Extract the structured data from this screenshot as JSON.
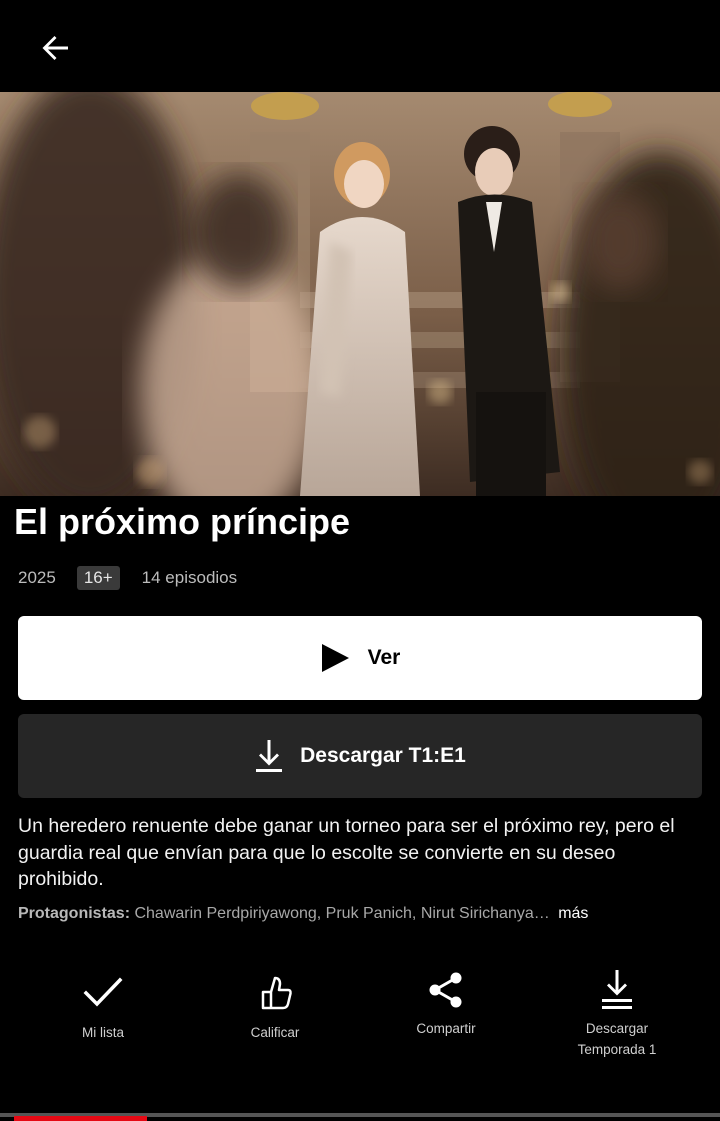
{
  "header": {
    "back_icon": "arrow-left-icon"
  },
  "hero": {
    "image": "Drama key art: two men facing each other on a palace staircase with blurred guests in the foreground"
  },
  "show": {
    "title": "El próximo príncipe",
    "year": "2025",
    "rating": "16+",
    "episodes": "14 episodios",
    "description": "Un heredero renuente debe ganar un torneo para ser el próximo rey, pero el guardia real que envían para que lo escolte se convierte en su deseo prohibido.",
    "cast_label": "Protagonistas:",
    "cast": " Chawarin Perdpiriyawong, Pruk Panich, Nirut Sirichanya…",
    "more": "más"
  },
  "buttons": {
    "play_label": "Ver",
    "play_icon": "play-icon",
    "download_label": "Descargar T1:E1",
    "download_icon": "download-icon"
  },
  "actions": [
    {
      "label": "Mi lista",
      "icon": "check-icon"
    },
    {
      "label": "Calificar",
      "icon": "thumbs-up-icon"
    },
    {
      "label": "Compartir",
      "icon": "share-icon"
    },
    {
      "label": "Descargar",
      "label2": "Temporada 1",
      "icon": "download-season-icon"
    }
  ],
  "progress": {
    "watched_fraction": 0.185
  },
  "colors": {
    "background": "#000000",
    "accent_red": "#e50914",
    "button_dark": "#262626"
  }
}
